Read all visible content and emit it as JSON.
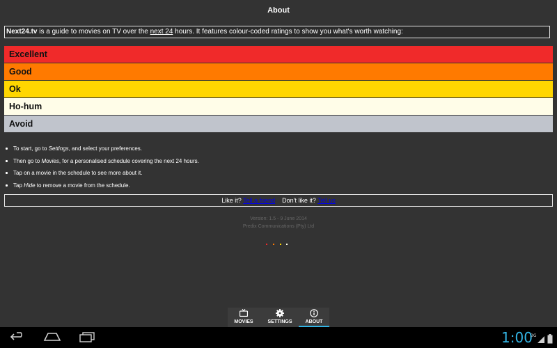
{
  "header": {
    "title": "About"
  },
  "intro": {
    "brand": "Next24.tv",
    "text_before": " is a guide to movies on TV over the ",
    "link": "next 24",
    "text_after": " hours. It features colour-coded ratings to show you what's worth watching:"
  },
  "ratings": [
    {
      "label": "Excellent",
      "color": "#f02a2a"
    },
    {
      "label": "Good",
      "color": "#ff7a00"
    },
    {
      "label": "Ok",
      "color": "#ffd600"
    },
    {
      "label": "Ho-hum",
      "color": "#fffde8"
    },
    {
      "label": "Avoid",
      "color": "#c0c4cc"
    }
  ],
  "tips": {
    "t1_pre": "To start, go to ",
    "t1_em": "Settings",
    "t1_post": ", and select your preferences.",
    "t2_pre": "Then go to ",
    "t2_em": "Movies",
    "t2_post": ", for a personalised schedule covering the next 24 hours.",
    "t3": "Tap on a movie in the schedule to see more about it.",
    "t4_pre": "Tap ",
    "t4_em": "Hide",
    "t4_post": " to remove a movie from the schedule."
  },
  "feedback": {
    "like_text": "Like it?",
    "like_link": "Tell a friend",
    "dislike_text": "Don't like it?",
    "dislike_link": "Tell us"
  },
  "footer": {
    "version": "Version: 1.5 - 9 June 2014",
    "company": "Predix Communications (Pty) Ltd"
  },
  "tabs": [
    {
      "label": "MOVIES",
      "icon": "tv-icon"
    },
    {
      "label": "SETTINGS",
      "icon": "gear-icon"
    },
    {
      "label": "ABOUT",
      "icon": "info-icon",
      "active": true
    }
  ],
  "status": {
    "time": "1:00",
    "network": "3G"
  },
  "colors": {
    "accent": "#33b5e5",
    "background": "#333333"
  }
}
